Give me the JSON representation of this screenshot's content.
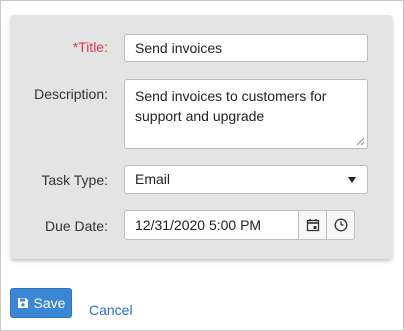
{
  "form": {
    "title": {
      "label": "*Title:",
      "value": "Send invoices"
    },
    "description": {
      "label": "Description:",
      "value": "Send invoices to customers for support and upgrade"
    },
    "task_type": {
      "label": "Task Type:",
      "selected": "Email"
    },
    "due_date": {
      "label": "Due Date:",
      "value": "12/31/2020 5:00 PM"
    }
  },
  "actions": {
    "save_label": "Save",
    "cancel_label": "Cancel"
  },
  "colors": {
    "panel_bg": "#e4e4e4",
    "required_label": "#e0394b",
    "primary_button": "#3a87d6",
    "link": "#2a6fcf"
  },
  "icons": {
    "save": "floppy-disk-icon",
    "calendar": "calendar-icon",
    "clock": "clock-icon",
    "select": "caret-down-icon",
    "resize": "resize-grip-icon"
  }
}
